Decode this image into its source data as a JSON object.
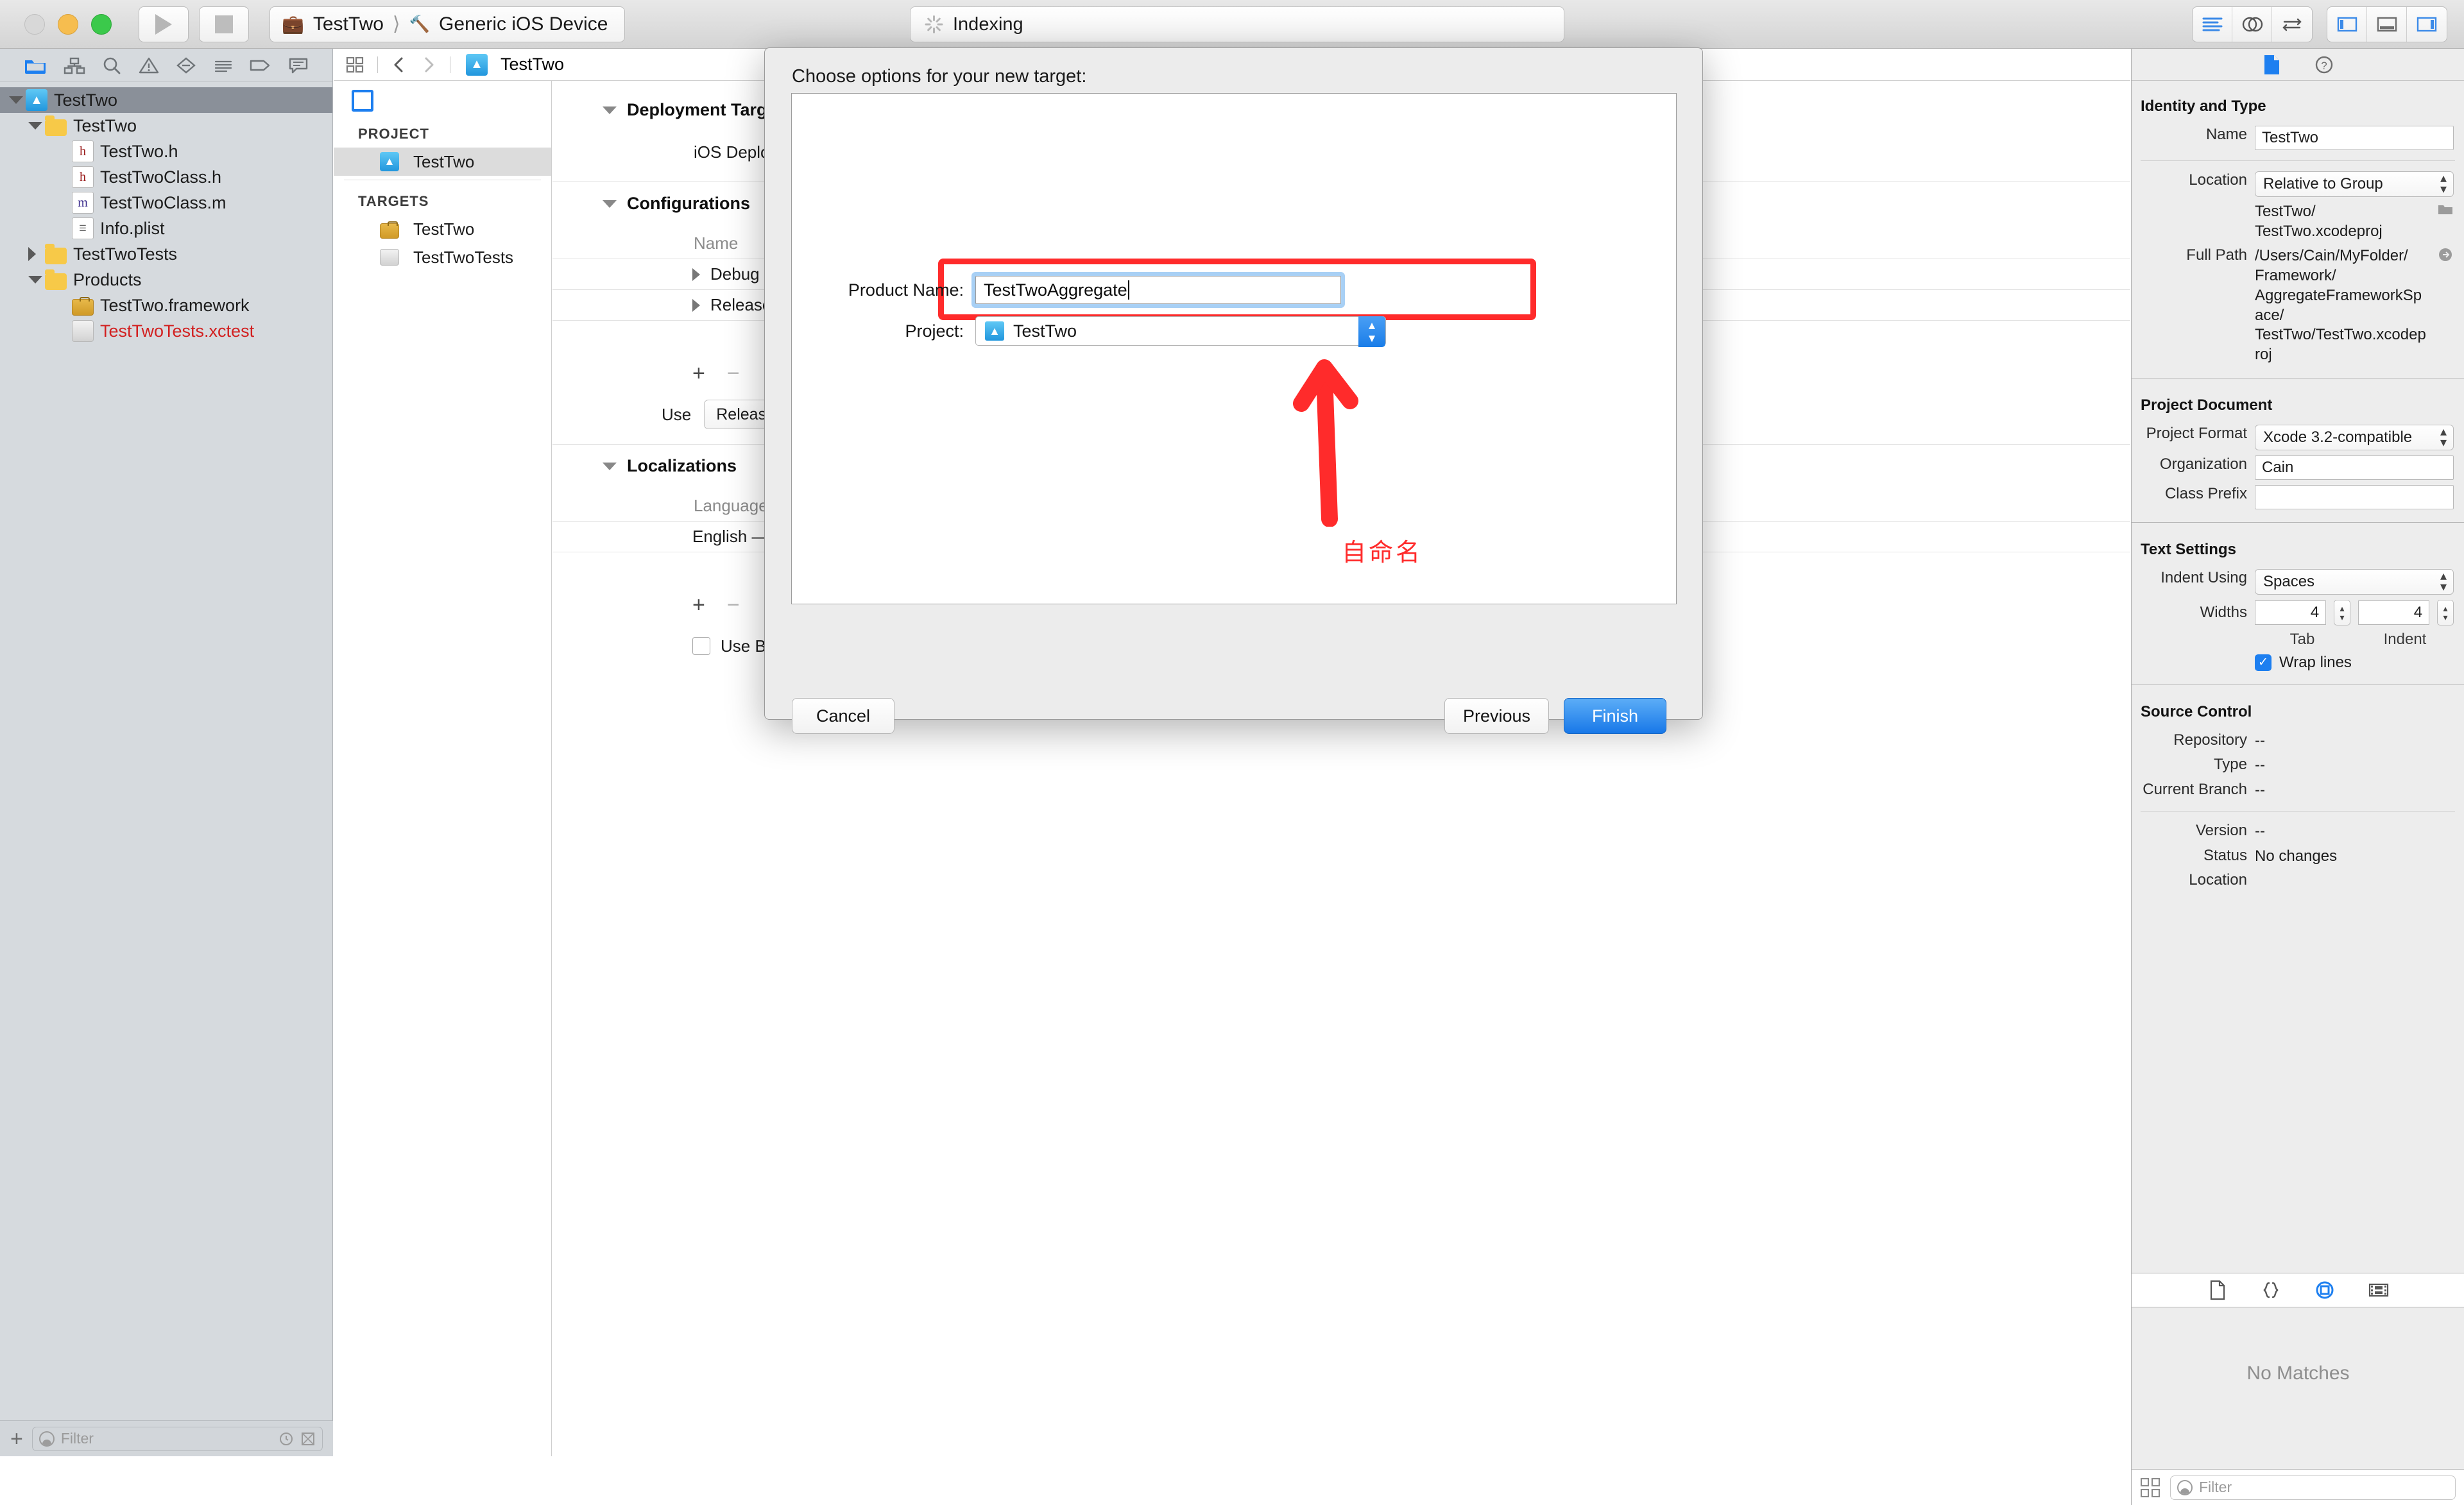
{
  "titlebar": {
    "scheme_project": "TestTwo",
    "scheme_device": "Generic iOS Device",
    "status": "Indexing",
    "traffic": {
      "close": "close-window",
      "minimize": "minimize-window",
      "maximize": "maximize-window"
    },
    "right_segments": [
      "standard-editor-icon",
      "assistant-editor-icon",
      "version-editor-icon",
      "toggle-navigator-icon",
      "toggle-debug-area-icon",
      "toggle-inspector-icon"
    ]
  },
  "navigator": {
    "toolbar_icons": [
      "project-navigator-icon",
      "symbol-navigator-icon",
      "find-navigator-icon",
      "issue-navigator-icon",
      "test-navigator-icon",
      "debug-navigator-icon",
      "breakpoint-navigator-icon",
      "report-navigator-icon"
    ],
    "tree": [
      {
        "label": "TestTwo",
        "indent": 0,
        "icon": "xcodeproj-icon",
        "twisty": "open",
        "selected": true
      },
      {
        "label": "TestTwo",
        "indent": 1,
        "icon": "folder-icon",
        "twisty": "open",
        "selected": false
      },
      {
        "label": "TestTwo.h",
        "indent": 2,
        "icon": "header-file-icon",
        "twisty": "none",
        "selected": false
      },
      {
        "label": "TestTwoClass.h",
        "indent": 2,
        "icon": "header-file-icon",
        "twisty": "none",
        "selected": false
      },
      {
        "label": "TestTwoClass.m",
        "indent": 2,
        "icon": "implementation-file-icon",
        "twisty": "none",
        "selected": false
      },
      {
        "label": "Info.plist",
        "indent": 2,
        "icon": "plist-file-icon",
        "twisty": "none",
        "selected": false
      },
      {
        "label": "TestTwoTests",
        "indent": 1,
        "icon": "folder-icon",
        "twisty": "closed",
        "selected": false
      },
      {
        "label": "Products",
        "indent": 1,
        "icon": "folder-icon",
        "twisty": "open",
        "selected": false
      },
      {
        "label": "TestTwo.framework",
        "indent": 2,
        "icon": "framework-icon",
        "twisty": "none",
        "selected": false
      },
      {
        "label": "TestTwoTests.xctest",
        "indent": 2,
        "icon": "xctest-icon",
        "twisty": "none",
        "selected": false,
        "red": true
      }
    ],
    "filter_placeholder": "Filter",
    "add_label": "+"
  },
  "editor": {
    "jumpbar": {
      "title": "TestTwo",
      "back_icon": "chevron-left-icon",
      "forward_icon": "chevron-right-icon",
      "related_icon": "related-items-icon"
    },
    "project_pane": {
      "project_header": "PROJECT",
      "project_items": [
        {
          "label": "TestTwo",
          "selected": true
        }
      ],
      "targets_header": "TARGETS",
      "target_items": [
        {
          "label": "TestTwo"
        },
        {
          "label": "TestTwoTests"
        }
      ]
    },
    "info_tab": "project-info-tab",
    "sections": {
      "deployment_title": "Deployment Target",
      "deployment_label": "iOS Deployment T",
      "configurations_title": "Configurations",
      "configurations_col": "Name",
      "configurations": [
        "Debug",
        "Release"
      ],
      "use_label": "Use",
      "use_value": "Release",
      "localizations_title": "Localizations",
      "localizations_col": "Language",
      "localizations": [
        "English — Development L"
      ],
      "base_internationalization": "Use Base Internatio",
      "add_label": "+",
      "remove_label": "−"
    }
  },
  "modal": {
    "title": "Choose options for your new target:",
    "product_name_label": "Product Name:",
    "product_name_value": "TestTwoAggregate",
    "project_label": "Project:",
    "project_value": "TestTwo",
    "annotation": "自命名",
    "cancel_label": "Cancel",
    "previous_label": "Previous",
    "finish_label": "Finish",
    "highlight_color": "#ff2b2b",
    "accent_color": "#1878e8"
  },
  "inspector": {
    "tabs": [
      "file-inspector-icon",
      "quick-help-icon"
    ],
    "identity": {
      "title": "Identity and Type",
      "name_label": "Name",
      "name_value": "TestTwo",
      "location_label": "Location",
      "location_value": "Relative to Group",
      "location_path": "TestTwo/\nTestTwo.xcodeproj",
      "full_path_label": "Full Path",
      "full_path_value": "/Users/Cain/MyFolder/\nFramework/\nAggregateFrameworkSpace/\nTestTwo/TestTwo.xcodeproj"
    },
    "document": {
      "title": "Project Document",
      "format_label": "Project Format",
      "format_value": "Xcode 3.2-compatible",
      "org_label": "Organization",
      "org_value": "Cain",
      "prefix_label": "Class Prefix",
      "prefix_value": ""
    },
    "text_settings": {
      "title": "Text Settings",
      "indent_label": "Indent Using",
      "indent_value": "Spaces",
      "widths_label": "Widths",
      "tab_value": "4",
      "indent_width_value": "4",
      "tab_caption": "Tab",
      "indent_caption": "Indent",
      "wrap_label": "Wrap lines",
      "wrap_checked": true
    },
    "source_control": {
      "title": "Source Control",
      "rows": [
        {
          "label": "Repository",
          "value": "--"
        },
        {
          "label": "Type",
          "value": "--"
        },
        {
          "label": "Current Branch",
          "value": "--"
        }
      ],
      "rows2": [
        {
          "label": "Version",
          "value": "--"
        },
        {
          "label": "Status",
          "value": "No changes"
        },
        {
          "label": "Location",
          "value": ""
        }
      ]
    },
    "library": {
      "tabs": [
        "file-template-library-icon",
        "code-snippet-library-icon",
        "object-library-icon",
        "media-library-icon"
      ],
      "empty_message": "No Matches",
      "filter_placeholder": "Filter"
    }
  }
}
